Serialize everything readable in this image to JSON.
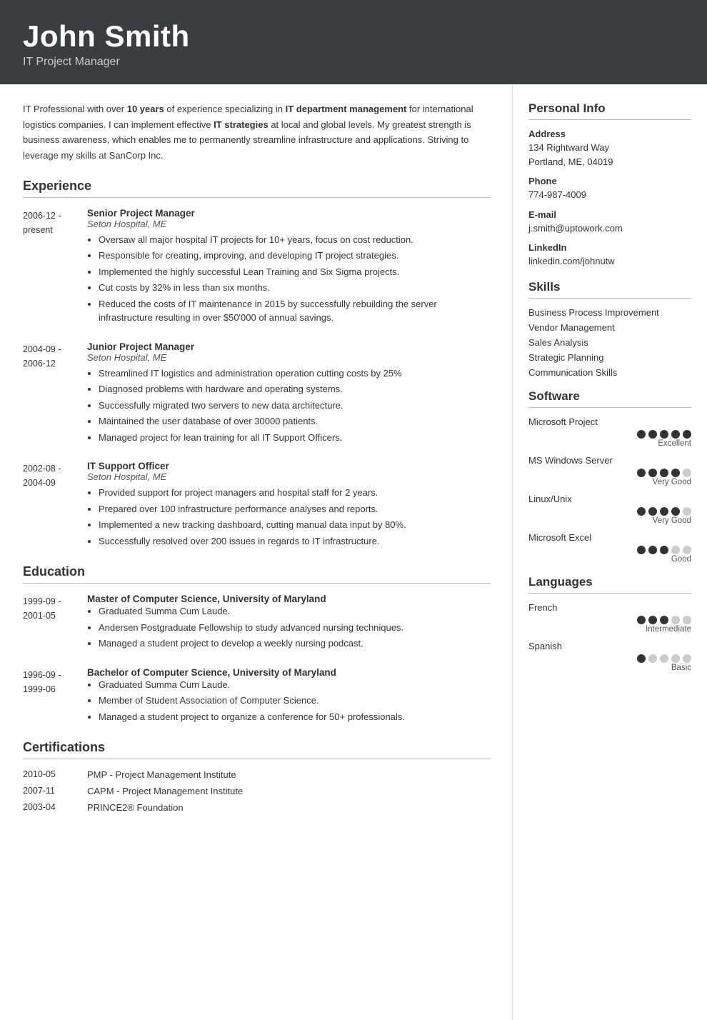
{
  "header": {
    "name": "John Smith",
    "title": "IT Project Manager"
  },
  "summary": {
    "text_parts": [
      "IT Professional with over ",
      "10 years",
      " of experience specializing in ",
      "IT department management",
      " for international logistics companies. I can implement effective ",
      "IT strategies",
      " at local and global levels. My greatest strength is business awareness, which enables me to permanently streamline infrastructure and applications. Striving to leverage my skills at SanCorp Inc."
    ]
  },
  "experience": {
    "section_label": "Experience",
    "items": [
      {
        "date_start": "2006-12 -",
        "date_end": "present",
        "title": "Senior Project Manager",
        "company": "Seton Hospital, ME",
        "bullets": [
          "Oversaw all major hospital IT projects for 10+ years, focus on cost reduction.",
          "Responsible for creating, improving, and developing IT project strategies.",
          "Implemented the highly successful Lean Training and Six Sigma projects.",
          "Cut costs by 32% in less than six months.",
          "Reduced the costs of IT maintenance in 2015 by successfully rebuilding the server infrastructure resulting in over $50'000 of annual savings."
        ]
      },
      {
        "date_start": "2004-09 -",
        "date_end": "2006-12",
        "title": "Junior Project Manager",
        "company": "Seton Hospital, ME",
        "bullets": [
          "Streamlined IT logistics and administration operation cutting costs by 25%",
          "Diagnosed problems with hardware and operating systems.",
          "Successfully migrated two servers to new data architecture.",
          "Maintained the user database of over 30000 patients.",
          "Managed project for lean training for all IT Support Officers."
        ]
      },
      {
        "date_start": "2002-08 -",
        "date_end": "2004-09",
        "title": "IT Support Officer",
        "company": "Seton Hospital, ME",
        "bullets": [
          "Provided support for project managers and hospital staff for 2 years.",
          "Prepared over 100 infrastructure performance analyses and reports.",
          "Implemented a new tracking dashboard, cutting manual data input by 80%.",
          "Successfully resolved over 200 issues in regards to IT infrastructure."
        ]
      }
    ]
  },
  "education": {
    "section_label": "Education",
    "items": [
      {
        "date_start": "1999-09 -",
        "date_end": "2001-05",
        "degree": "Master of Computer Science, University of Maryland",
        "bullets": [
          "Graduated Summa Cum Laude.",
          "Andersen Postgraduate Fellowship to study advanced nursing techniques.",
          "Managed a student project to develop a weekly nursing podcast."
        ]
      },
      {
        "date_start": "1996-09 -",
        "date_end": "1999-06",
        "degree": "Bachelor of Computer Science, University of Maryland",
        "bullets": [
          "Graduated Summa Cum Laude.",
          "Member of Student Association of Computer Science.",
          "Managed a student project to organize a conference for 50+ professionals."
        ]
      }
    ]
  },
  "certifications": {
    "section_label": "Certifications",
    "items": [
      {
        "date": "2010-05",
        "name": "PMP - Project Management Institute"
      },
      {
        "date": "2007-11",
        "name": "CAPM - Project Management Institute"
      },
      {
        "date": "2003-04",
        "name": "PRINCE2® Foundation"
      }
    ]
  },
  "personal_info": {
    "section_label": "Personal Info",
    "fields": [
      {
        "label": "Address",
        "value": "134 Rightward Way\nPortland, ME, 04019"
      },
      {
        "label": "Phone",
        "value": "774-987-4009"
      },
      {
        "label": "E-mail",
        "value": "j.smith@uptowork.com"
      },
      {
        "label": "LinkedIn",
        "value": "linkedin.com/johnutw"
      }
    ]
  },
  "skills": {
    "section_label": "Skills",
    "items": [
      "Business Process Improvement",
      "Vendor Management",
      "Sales Analysis",
      "Strategic Planning",
      "Communication Skills"
    ]
  },
  "software": {
    "section_label": "Software",
    "items": [
      {
        "name": "Microsoft Project",
        "filled": 5,
        "total": 5,
        "label": "Excellent"
      },
      {
        "name": "MS Windows Server",
        "filled": 4,
        "total": 5,
        "label": "Very Good"
      },
      {
        "name": "Linux/Unix",
        "filled": 4,
        "total": 5,
        "label": "Very Good"
      },
      {
        "name": "Microsoft Excel",
        "filled": 3,
        "total": 5,
        "label": "Good"
      }
    ]
  },
  "languages": {
    "section_label": "Languages",
    "items": [
      {
        "name": "French",
        "filled": 3,
        "total": 5,
        "label": "Intermediate"
      },
      {
        "name": "Spanish",
        "filled": 1,
        "total": 5,
        "label": "Basic"
      }
    ]
  }
}
